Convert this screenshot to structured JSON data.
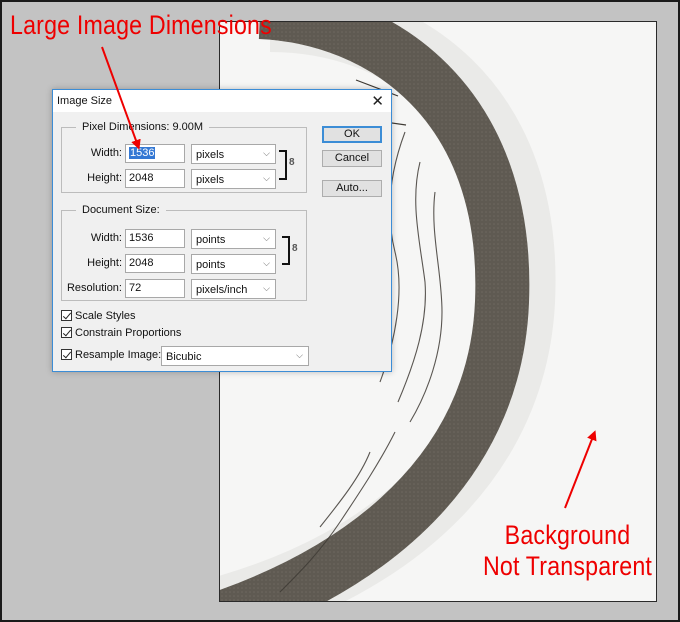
{
  "annotations": {
    "top": "Large Image Dimensions",
    "bottom_line1": "Background",
    "bottom_line2": "Not Transparent"
  },
  "dialog": {
    "title": "Image Size",
    "close_icon": "close-icon",
    "pixel_dimensions": {
      "label": "Pixel Dimensions:",
      "value": "9.00M",
      "width_label": "Width:",
      "width_value": "1536",
      "width_unit": "pixels",
      "height_label": "Height:",
      "height_value": "2048",
      "height_unit": "pixels"
    },
    "document_size": {
      "label": "Document Size:",
      "width_label": "Width:",
      "width_value": "1536",
      "width_unit": "points",
      "height_label": "Height:",
      "height_value": "2048",
      "height_unit": "points",
      "resolution_label": "Resolution:",
      "resolution_value": "72",
      "resolution_unit": "pixels/inch"
    },
    "checkboxes": [
      {
        "label": "Scale Styles",
        "checked": true
      },
      {
        "label": "Constrain Proportions",
        "checked": true
      },
      {
        "label": "Resample Image:",
        "checked": true
      }
    ],
    "resample_method": "Bicubic",
    "buttons": {
      "ok": "OK",
      "cancel": "Cancel",
      "auto": "Auto..."
    },
    "chevron": "⌵",
    "chain_glyph": "8"
  },
  "colors": {
    "annotation": "#ee0000",
    "dialog_accent": "#3c8dd6",
    "workspace": "#c3c3c3",
    "canvas": "#f6f6f5",
    "wheel": "#5f5a52"
  }
}
